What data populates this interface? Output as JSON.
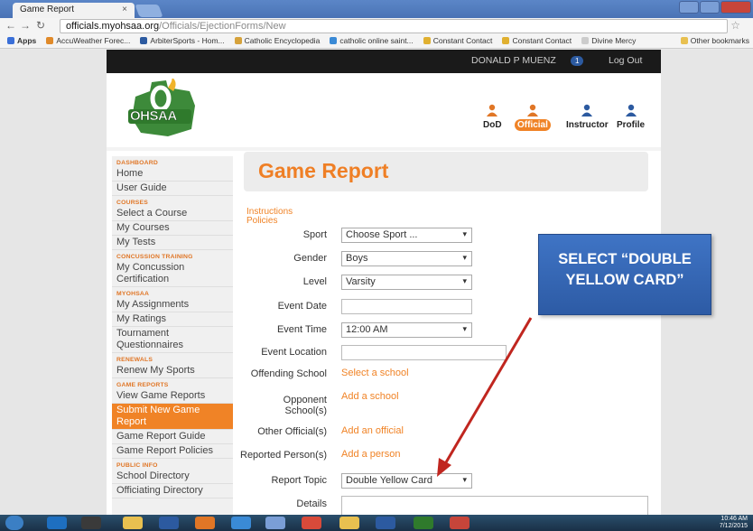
{
  "browser": {
    "tab_title": "Game Report",
    "tab_close": "×",
    "url_host": "officials.myohsaa.org",
    "url_path": "/Officials/EjectionForms/New",
    "bookmarks": [
      "Apps",
      "AccuWeather Forec...",
      "ArbiterSports - Hom...",
      "Catholic Encyclopedia",
      "catholic online saint...",
      "Constant Contact",
      "Constant Contact",
      "Divine Mercy"
    ],
    "other_bookmarks": "Other bookmarks"
  },
  "topbar": {
    "user": "DONALD P MUENZ",
    "badge": "1",
    "logout": "Log Out"
  },
  "logo": {
    "text": "OHSAA"
  },
  "roles": [
    {
      "label": "DoD",
      "active": false
    },
    {
      "label": "Official",
      "active": true
    },
    {
      "label": "Instructor",
      "active": false
    },
    {
      "label": "Profile",
      "active": false
    }
  ],
  "sidebar": {
    "dashboard": "DASHBOARD",
    "home": "Home",
    "user_guide": "User Guide",
    "courses": "COURSES",
    "select_course": "Select a Course",
    "my_courses": "My Courses",
    "my_tests": "My Tests",
    "concussion": "CONCUSSION TRAINING",
    "my_concussion": "My Concussion Certification",
    "myohsaa": "MYOHSAA",
    "my_assignments": "My Assignments",
    "my_ratings": "My Ratings",
    "tournament": "Tournament Questionnaires",
    "renewals": "RENEWALS",
    "renew_sports": "Renew My Sports",
    "game_reports": "GAME REPORTS",
    "view_reports": "View Game Reports",
    "submit_report": "Submit New Game Report",
    "report_guide": "Game Report Guide",
    "report_policies": "Game Report Policies",
    "public_info": "PUBLIC INFO",
    "school_directory": "School Directory",
    "officiating_directory": "Officiating Directory"
  },
  "main": {
    "title": "Game Report",
    "instructions": "Instructions",
    "policies": "Policies",
    "labels": {
      "sport": "Sport",
      "gender": "Gender",
      "level": "Level",
      "event_date": "Event Date",
      "event_time": "Event Time",
      "event_location": "Event Location",
      "offending_school": "Offending School",
      "opponent_schools": "Opponent School(s)",
      "other_officials": "Other Official(s)",
      "reported_persons": "Reported Person(s)",
      "report_topic": "Report Topic",
      "details": "Details"
    },
    "values": {
      "sport": "Choose Sport ...",
      "gender": "Boys",
      "level": "Varsity",
      "event_time": "12:00 AM",
      "offending_school": "Select a school",
      "opponent_schools": "Add a school",
      "other_officials": "Add an official",
      "reported_persons": "Add a person",
      "report_topic": "Double Yellow Card"
    }
  },
  "callout": {
    "line1": "SELECT “DOUBLE",
    "line2": "YELLOW CARD”"
  },
  "taskbar": {
    "time": "10:46 AM",
    "date": "7/12/2015"
  },
  "colors": {
    "accent": "#f08326",
    "callout": "#2d5ba5",
    "arrow": "#c0261f"
  }
}
